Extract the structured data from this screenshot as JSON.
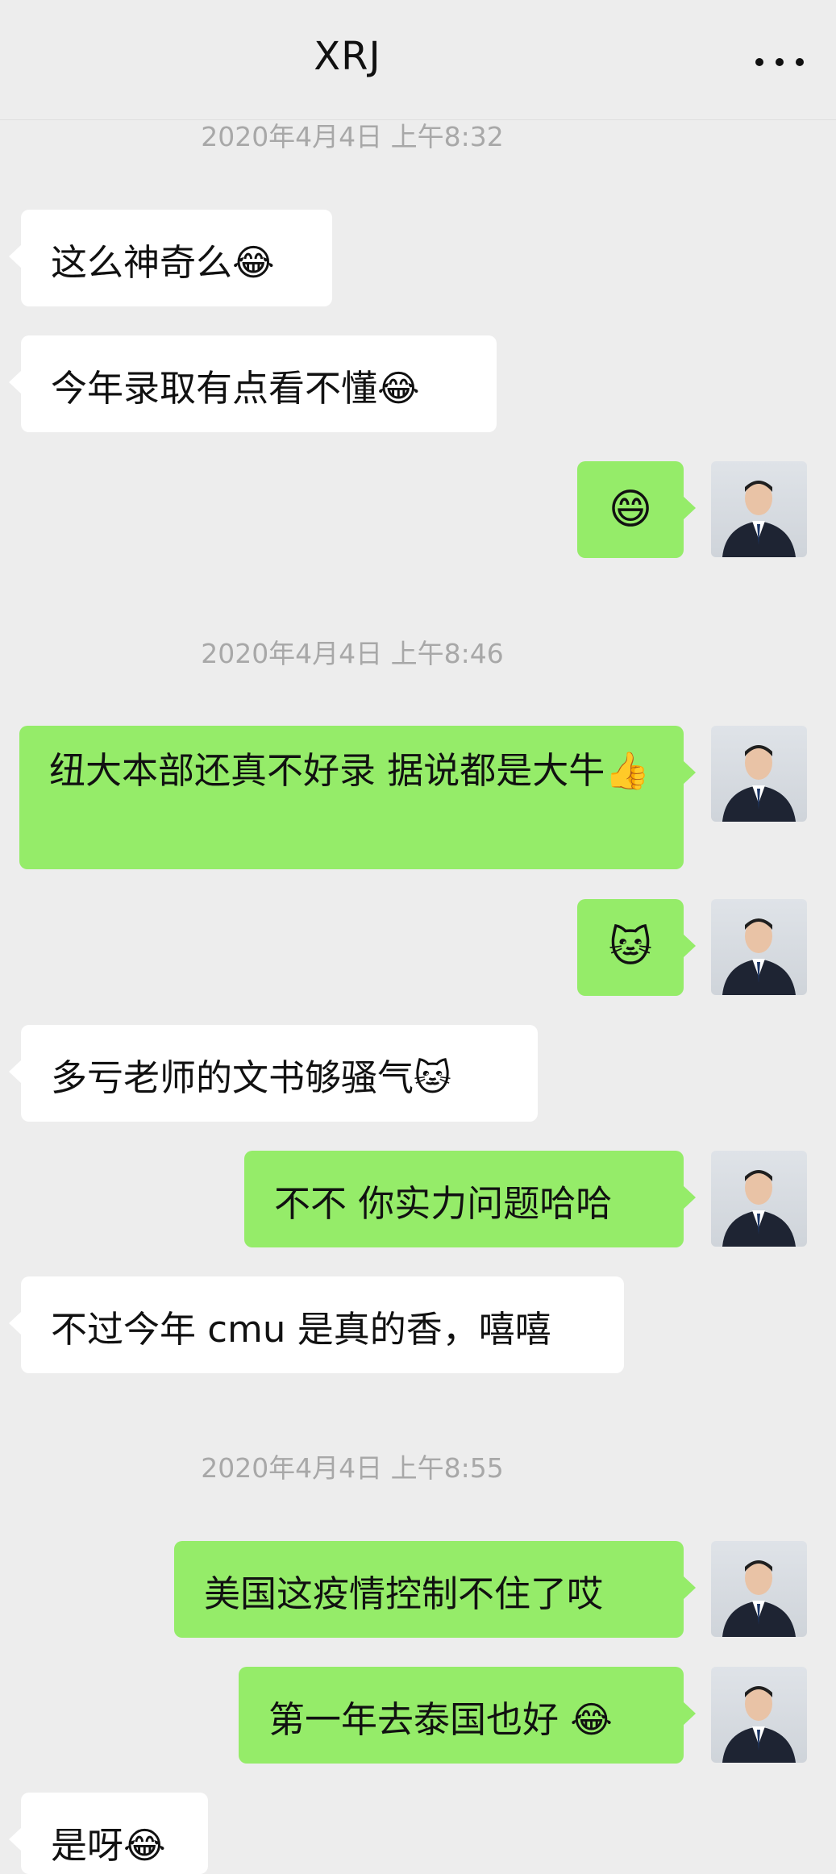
{
  "header": {
    "title": "XRJ",
    "more_label": "···"
  },
  "timestamps": {
    "t1": "2020年4月4日 上午8:32",
    "t2": "2020年4月4日 上午8:46",
    "t3": "2020年4月4日 上午8:55"
  },
  "messages": {
    "m1": "这么神奇么😂",
    "m2": "今年录取有点看不懂😂",
    "m3": "😄",
    "m4": "纽大本部还真不好录 据说都是大牛👍",
    "m5": "🐱",
    "m6": "多亏老师的文书够骚气🐱",
    "m7": "不不 你实力问题哈哈",
    "m8": "不过今年 cmu 是真的香，嘻嘻",
    "m9": "美国这疫情控制不住了哎",
    "m10": "第一年去泰国也好 😂",
    "m11": "是呀😂"
  },
  "icons": {
    "more": "more-dots-icon",
    "avatar": "user-avatar-icon"
  },
  "colors": {
    "background": "#ededed",
    "incoming_bubble": "#ffffff",
    "outgoing_bubble": "#95ec69",
    "timestamp": "#a8a8a8"
  }
}
